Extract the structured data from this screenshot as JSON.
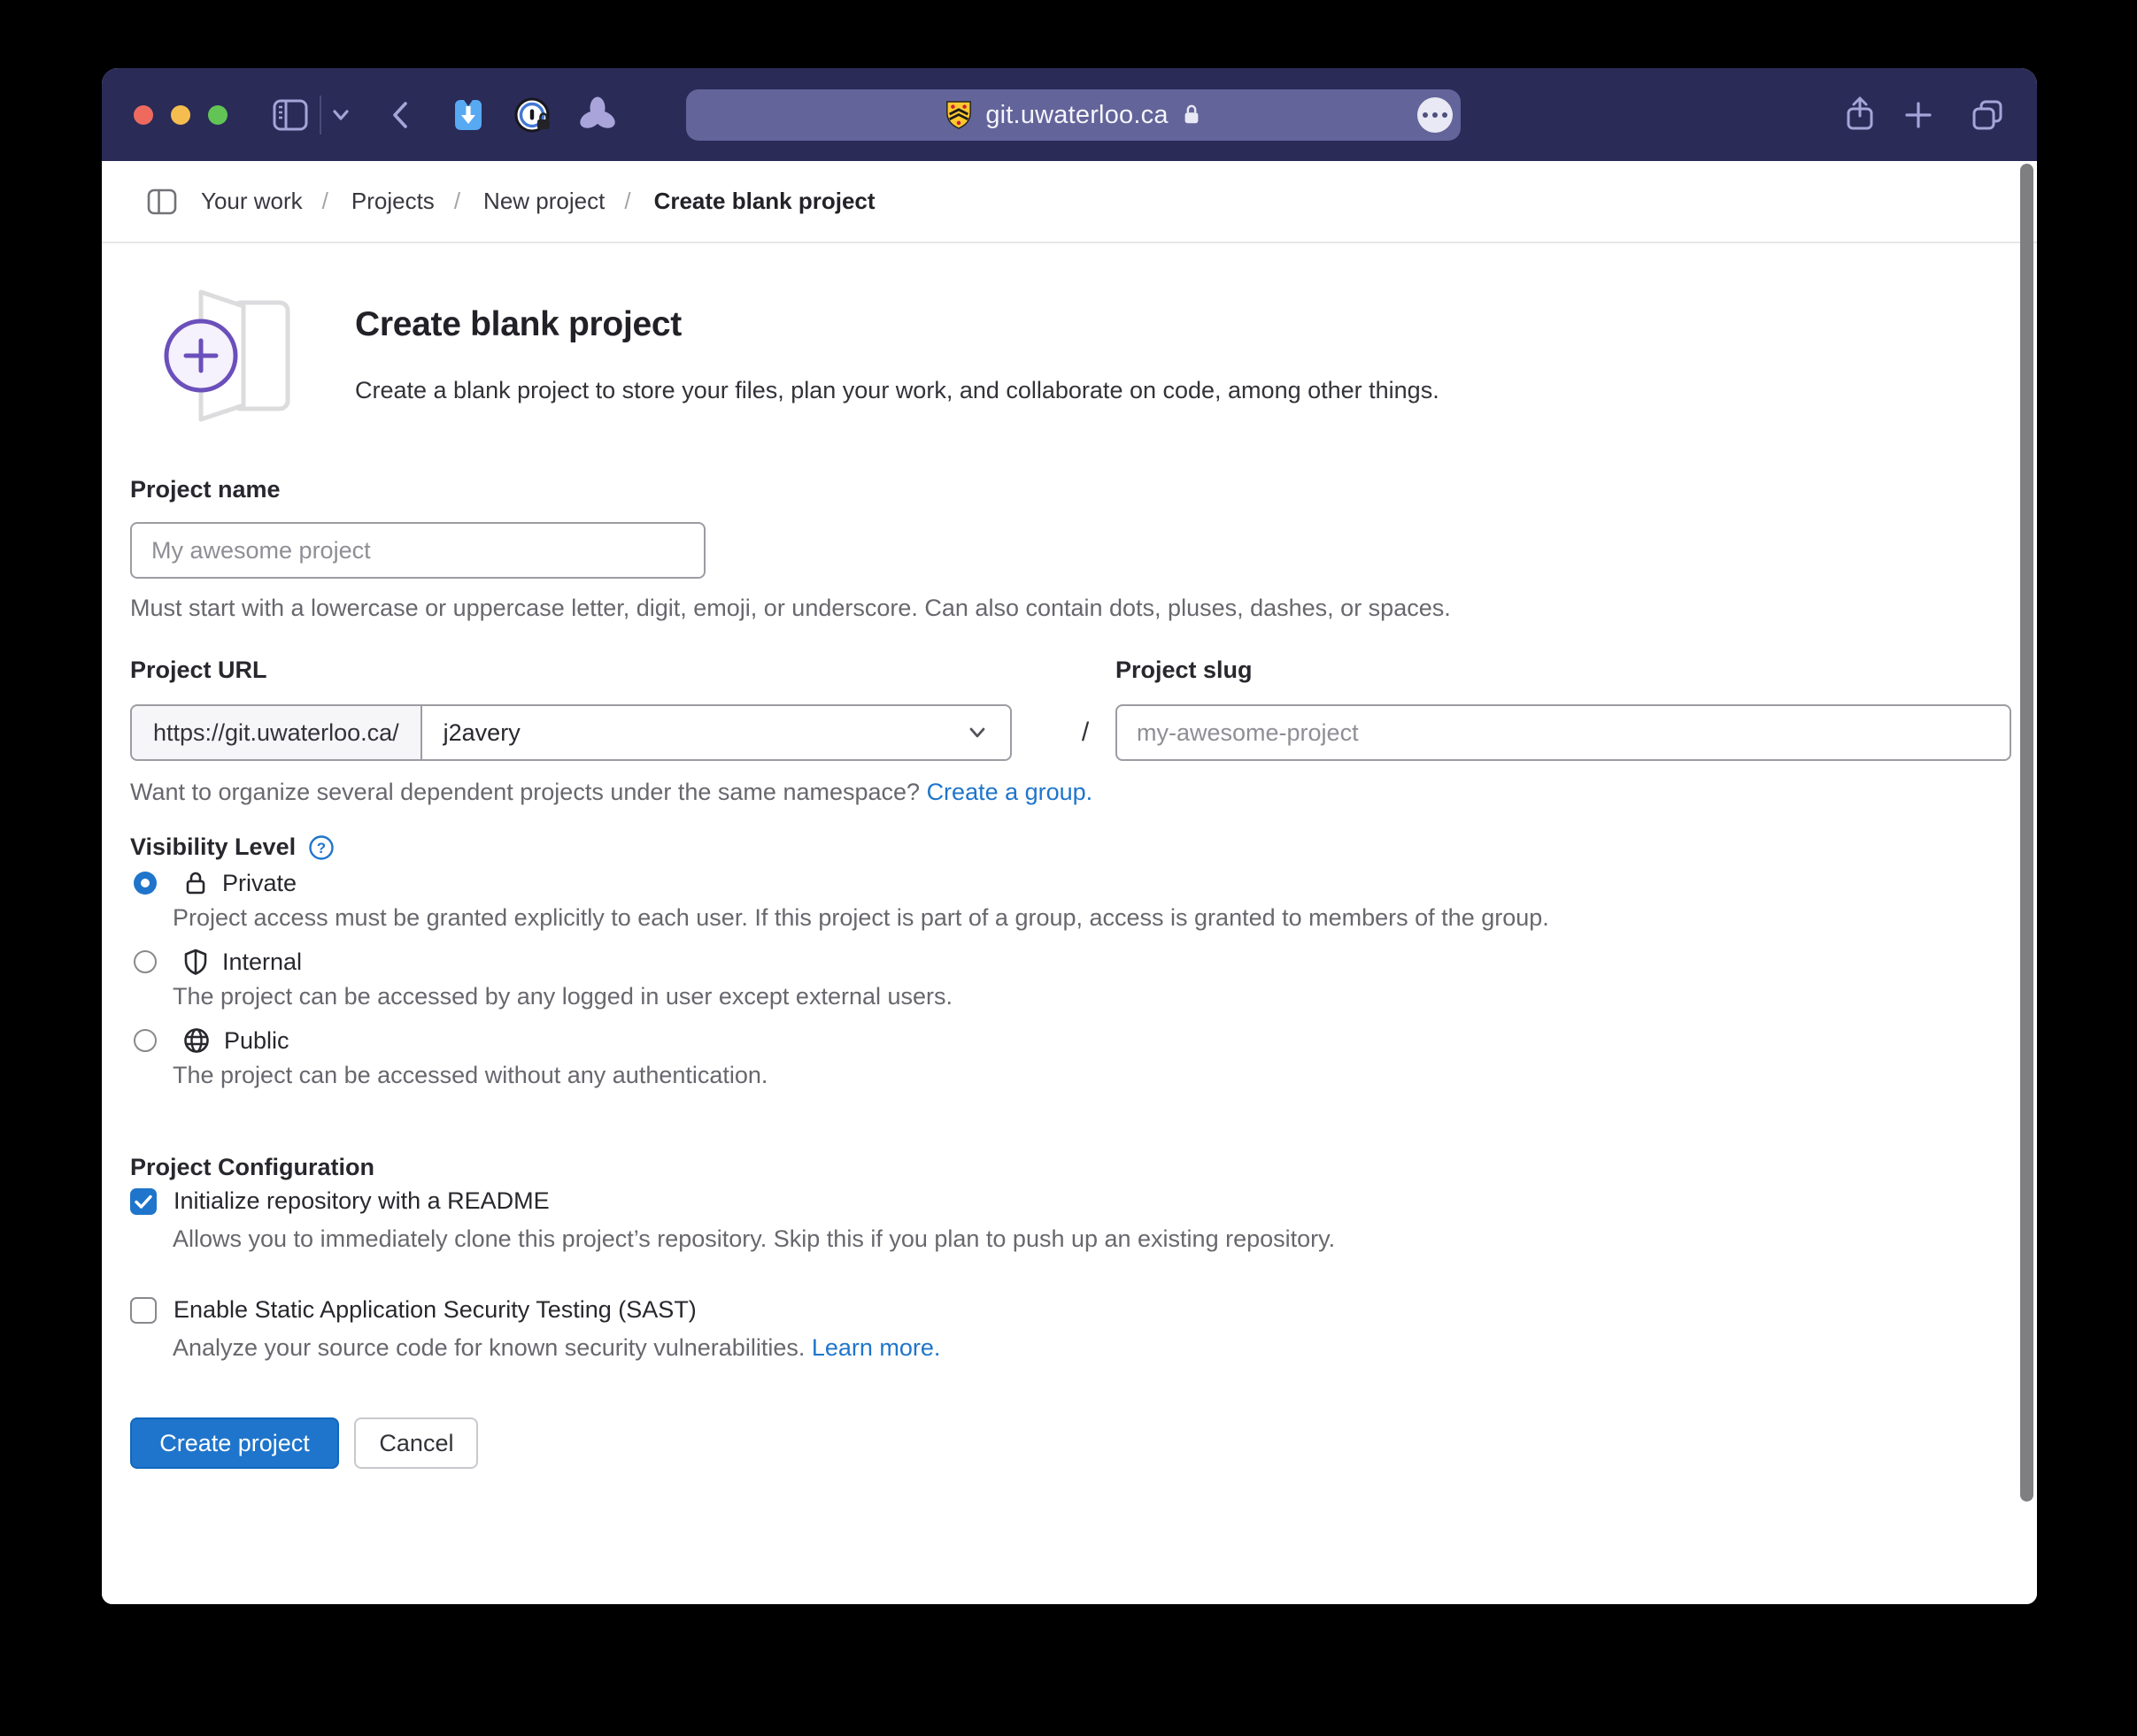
{
  "browser": {
    "url": "git.uwaterloo.ca"
  },
  "breadcrumb": {
    "items": [
      "Your work",
      "Projects",
      "New project"
    ],
    "current": "Create blank project",
    "separator": "/"
  },
  "header": {
    "title": "Create blank project",
    "description": "Create a blank project to store your files, plan your work, and collaborate on code, among other things."
  },
  "form": {
    "project_name": {
      "label": "Project name",
      "placeholder": "My awesome project",
      "help": "Must start with a lowercase or uppercase letter, digit, emoji, or underscore. Can also contain dots, pluses, dashes, or spaces."
    },
    "project_url": {
      "label": "Project URL",
      "prefix": "https://git.uwaterloo.ca/",
      "namespace": "j2avery",
      "separator": "/"
    },
    "project_slug": {
      "label": "Project slug",
      "placeholder": "my-awesome-project"
    },
    "namespace_help": {
      "text": "Want to organize several dependent projects under the same namespace?",
      "link": "Create a group."
    },
    "visibility": {
      "label": "Visibility Level",
      "options": [
        {
          "name": "Private",
          "description": "Project access must be granted explicitly to each user. If this project is part of a group, access is granted to members of the group.",
          "selected": true
        },
        {
          "name": "Internal",
          "description": "The project can be accessed by any logged in user except external users.",
          "selected": false
        },
        {
          "name": "Public",
          "description": "The project can be accessed without any authentication.",
          "selected": false
        }
      ]
    },
    "configuration": {
      "label": "Project Configuration",
      "options": [
        {
          "name": "Initialize repository with a README",
          "description": "Allows you to immediately clone this project’s repository. Skip this if you plan to push up an existing repository.",
          "checked": true
        },
        {
          "name": "Enable Static Application Security Testing (SAST)",
          "description": "Analyze your source code for known security vulnerabilities.",
          "link": "Learn more.",
          "checked": false
        }
      ]
    },
    "actions": {
      "submit": "Create project",
      "cancel": "Cancel"
    }
  },
  "colors": {
    "accent_blue": "#1f75cb",
    "toolbar": "#2a2b57",
    "urlbar": "#63649a",
    "purple_accent": "#6b4fbb"
  }
}
